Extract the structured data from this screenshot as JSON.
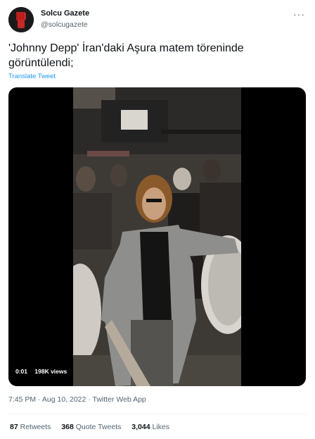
{
  "author": {
    "name": "Solcu Gazete",
    "handle": "@solcugazete",
    "avatar_icon": "raised-fist-logo"
  },
  "more_icon": "more-dots-icon",
  "tweet": {
    "text": "'Johnny Depp' İran'daki Aşura matem töreninde görüntülendi;",
    "translate_label": "Translate Tweet"
  },
  "video": {
    "timestamp": "0:01",
    "views": "198K views"
  },
  "meta": {
    "time": "7:45 PM",
    "separator1": "·",
    "date": "Aug 10, 2022",
    "separator2": "·",
    "source": "Twitter Web App"
  },
  "stats": {
    "retweets_count": "87",
    "retweets_label": "Retweets",
    "quotes_count": "368",
    "quotes_label": "Quote Tweets",
    "likes_count": "3,044",
    "likes_label": "Likes"
  },
  "colors": {
    "link": "#1d9bf0",
    "secondary_text": "#536471",
    "avatar_fist": "#c62828"
  }
}
